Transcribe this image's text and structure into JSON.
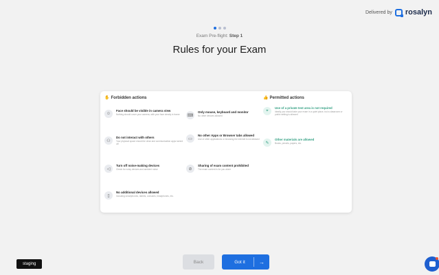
{
  "header": {
    "delivered_by": "Delivered by",
    "brand_name": "rosalyn"
  },
  "step": {
    "label_prefix": "Exam Pre-flight:",
    "label_step": "Step 1"
  },
  "page_title": "Rules for your Exam",
  "forbidden": {
    "title": "Forbidden actions",
    "items": [
      {
        "title": "Face should be visible in camera view",
        "desc": "Nothing should cover your camera, with your face clearly in frame",
        "icon": "face-icon"
      },
      {
        "title": "Do not interact with others",
        "desc": "Your physical space should be clear and communication apps turned off",
        "icon": "people-icon"
      },
      {
        "title": "Turn off noise-making devices",
        "desc": "Check for noisy devices and ambient noise",
        "icon": "speaker-off-icon"
      },
      {
        "title": "No additional devices allowed",
        "desc": "Including smartphones, tablets, consoles, headphones, etc.",
        "icon": "devices-icon"
      },
      {
        "title": "Only mouse, keyboard and monitor",
        "desc": "No other devices allowed",
        "icon": "keyboard-icon"
      },
      {
        "title": "No other Apps or Browser tabs allowed",
        "desc": "Use of other applications or browsing the internet is not allowed",
        "icon": "browser-tabs-icon"
      },
      {
        "title": "Sharing of exam content prohibited",
        "desc": "The exam content is for you alone",
        "icon": "share-blocked-icon"
      }
    ]
  },
  "permitted": {
    "title": "Permitted actions",
    "items": [
      {
        "title": "Use of a private test area is not required",
        "desc": "Ideally you should take your exam in a quiet place, but a classroom or public setting is allowed",
        "icon": "location-icon"
      },
      {
        "title": "Other materials are allowed",
        "desc": "Books, pencils, papers, etc.",
        "icon": "pencil-icon"
      }
    ]
  },
  "footer": {
    "staging_label": "staging",
    "back_label": "Back",
    "got_it_label": "Got it",
    "arrow": "→"
  },
  "colors": {
    "accent": "#1e6fe0",
    "permitted": "#2d9d7f"
  }
}
